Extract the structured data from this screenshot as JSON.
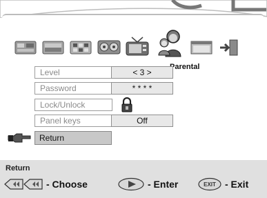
{
  "menu": {
    "icons": [
      {
        "name": "language-settings-icon"
      },
      {
        "name": "video-settings-icon"
      },
      {
        "name": "audio-settings-icon"
      },
      {
        "name": "speaker-settings-icon"
      },
      {
        "name": "tv-display-icon"
      },
      {
        "name": "parental-icon",
        "selected": true
      },
      {
        "name": "setup-screen-icon"
      },
      {
        "name": "exit-menu-icon"
      }
    ],
    "selected_caption": "Parental"
  },
  "options": [
    {
      "label": "Level",
      "value": "< 3 >"
    },
    {
      "label": "Password",
      "value": "* * * *"
    },
    {
      "label": "Lock/Unlock",
      "value_icon": "lock-icon"
    },
    {
      "label": "Panel keys",
      "value": "Off"
    }
  ],
  "return_item": {
    "label": "Return",
    "pointer_icon": "pointing-hand-icon"
  },
  "footer": {
    "title": "Return",
    "hints": [
      {
        "icon": "left-right-keys-icon",
        "text": "- Choose"
      },
      {
        "icon": "play-key-icon",
        "text": "- Enter"
      },
      {
        "icon": "exit-key-icon",
        "key_label": "EXIT",
        "text": "- Exit"
      }
    ]
  },
  "colors": {
    "footer_bg": "#e0e0e0",
    "value_bg": "#e8e8e8",
    "return_bg": "#c8c8c8"
  }
}
